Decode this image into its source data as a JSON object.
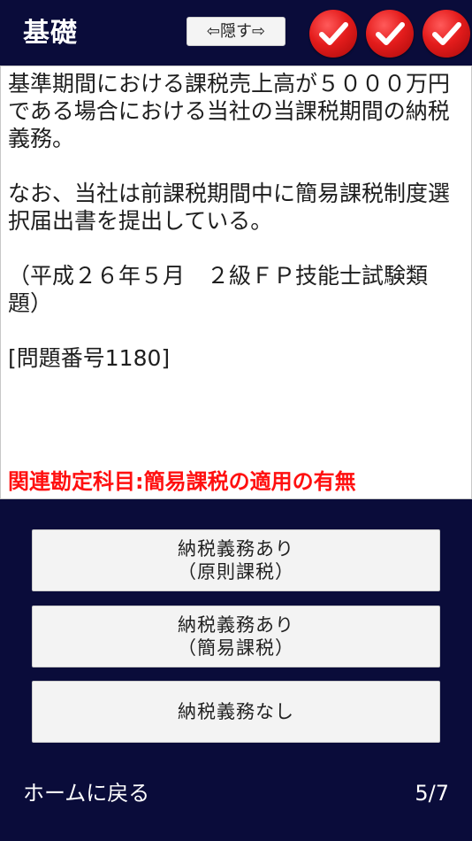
{
  "header": {
    "title": "基礎",
    "hide_label": "⇦隠す⇨",
    "checks": [
      "check-icon",
      "check-icon",
      "check-icon"
    ],
    "check_color": "#e41c1c"
  },
  "question": {
    "text": "基準期間における課税売上高が５０００万円である場合における当社の当課税期間の納税義務。\n\nなお、当社は前課税期間中に簡易課税制度選択届出書を提出している。\n\n（平成２６年５月　２級ＦＰ技能士試験類題）\n\n[問題番号1180]",
    "related_subject": "関連勘定科目:簡易課税の適用の有無",
    "related_color": "#ff1010"
  },
  "answers": [
    {
      "line1": "納税義務あり",
      "line2": "（原則課税）"
    },
    {
      "line1": "納税義務あり",
      "line2": "（簡易課税）"
    },
    {
      "line1": "納税義務なし",
      "line2": ""
    }
  ],
  "footer": {
    "home_label": "ホームに戻る",
    "progress": "5/7"
  }
}
